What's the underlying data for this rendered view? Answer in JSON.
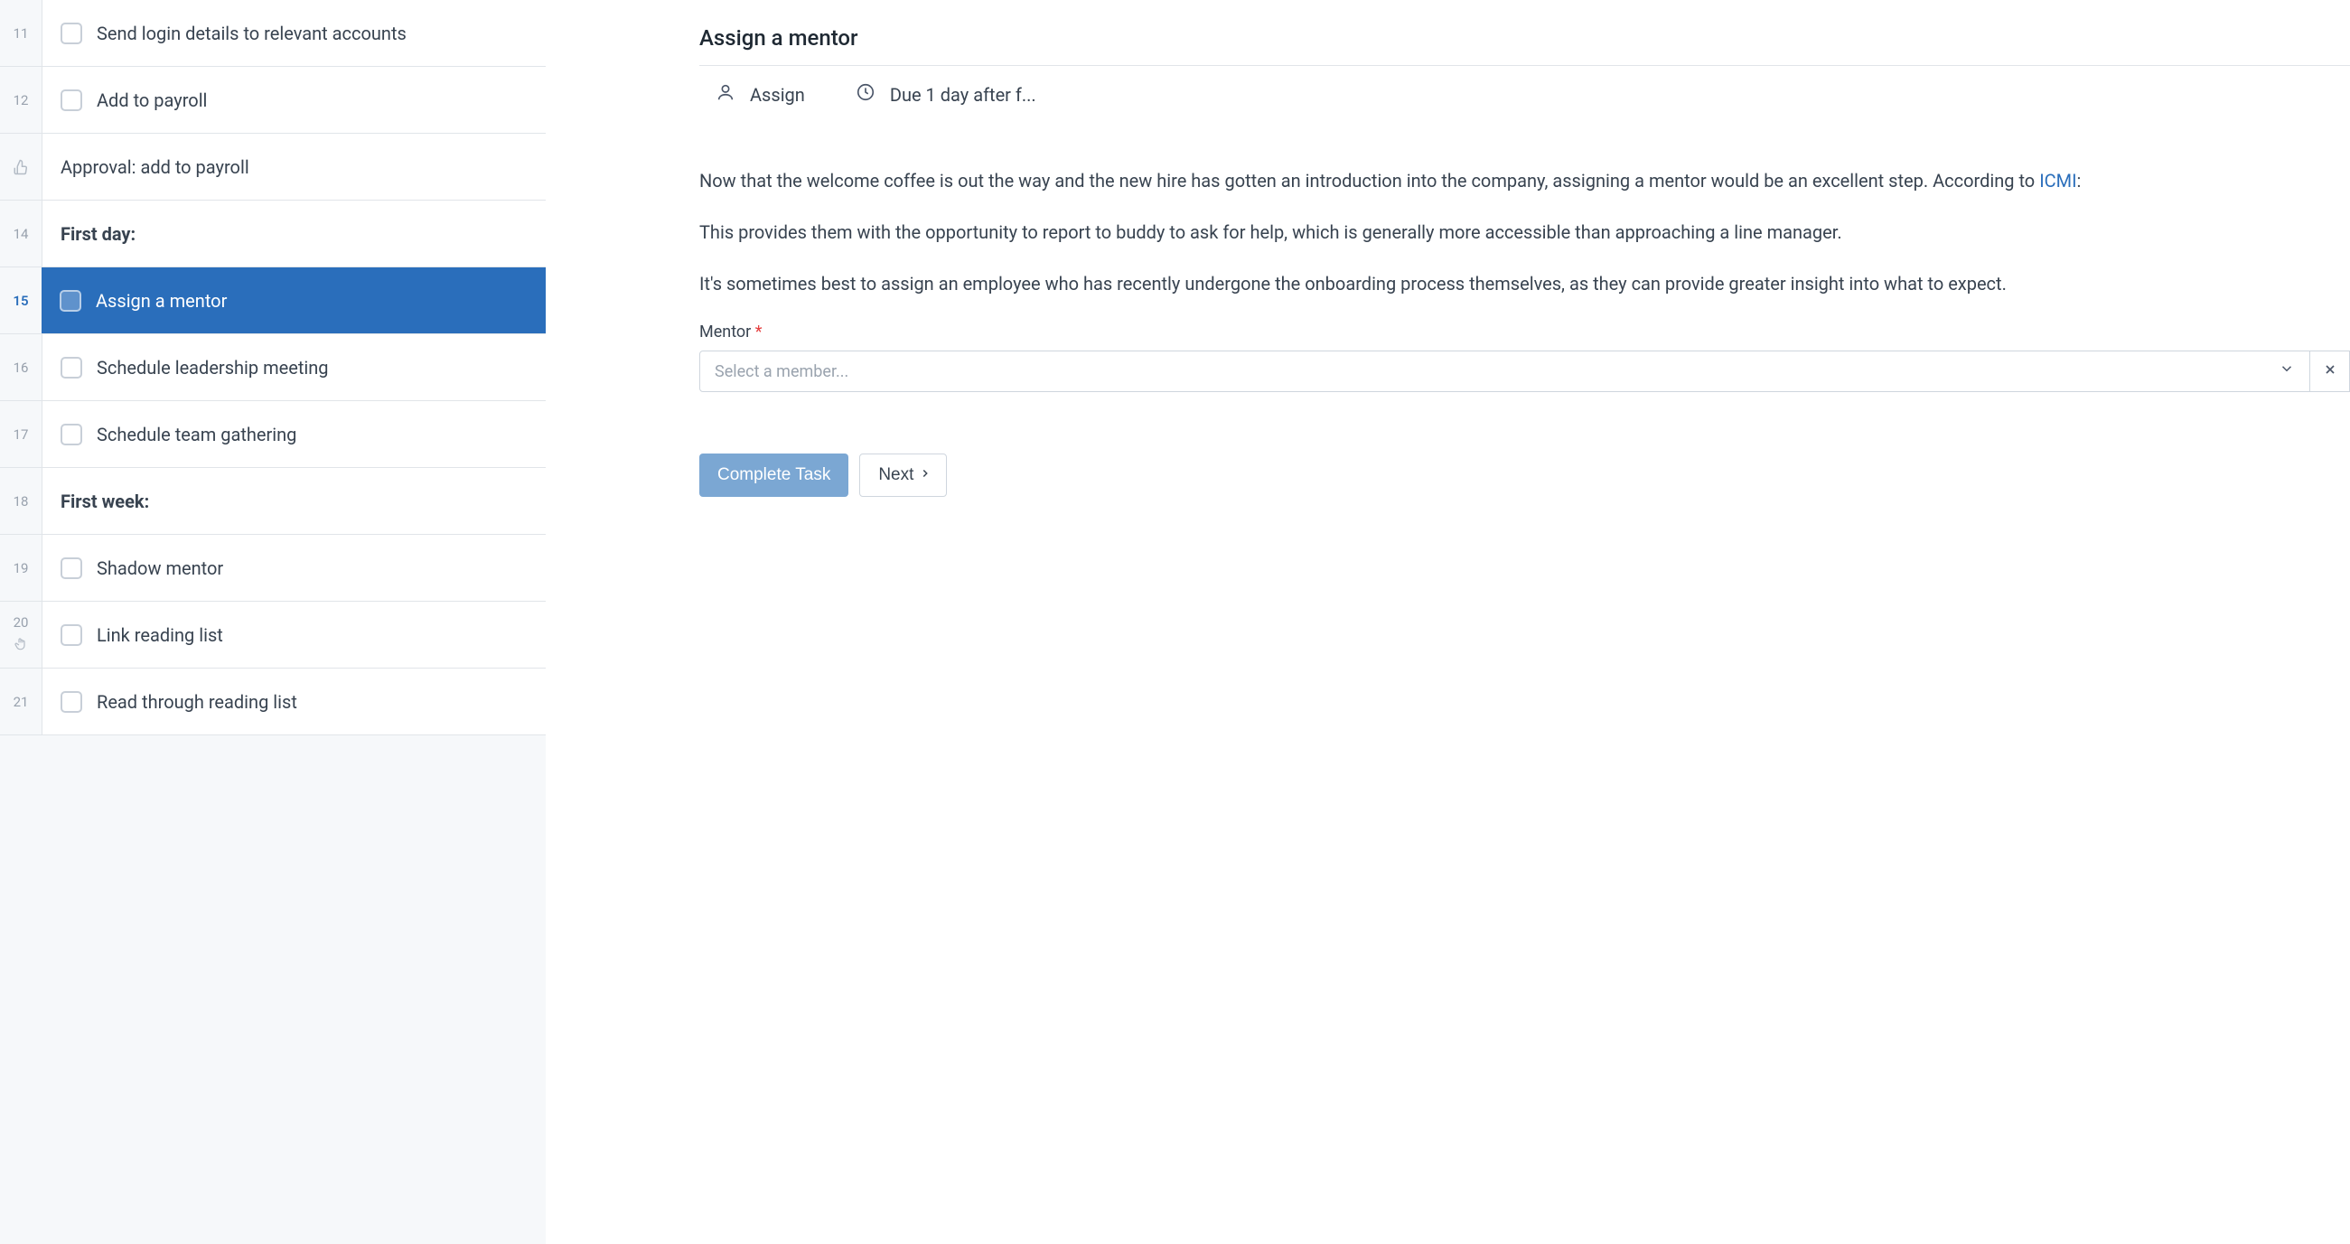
{
  "sidebar": {
    "rows": [
      {
        "num": "11",
        "type": "task",
        "label": "Send login details to relevant accounts"
      },
      {
        "num": "12",
        "type": "task",
        "label": "Add to payroll"
      },
      {
        "num": "",
        "type": "approval",
        "label": "Approval: add to payroll"
      },
      {
        "num": "14",
        "type": "heading",
        "label": "First day:"
      },
      {
        "num": "15",
        "type": "task",
        "label": "Assign a mentor",
        "active": true
      },
      {
        "num": "16",
        "type": "task",
        "label": "Schedule leadership meeting"
      },
      {
        "num": "17",
        "type": "task",
        "label": "Schedule team gathering"
      },
      {
        "num": "18",
        "type": "heading",
        "label": "First week:"
      },
      {
        "num": "19",
        "type": "task",
        "label": "Shadow mentor"
      },
      {
        "num": "20",
        "type": "task",
        "label": "Link reading list",
        "hasHand": true
      },
      {
        "num": "21",
        "type": "task",
        "label": "Read through reading list"
      }
    ]
  },
  "detail": {
    "title": "Assign a mentor",
    "meta_assign": "Assign",
    "meta_due": "Due 1 day after f...",
    "para1_prefix": "Now that the welcome coffee is out the way and the new hire has gotten an introduction into the company, assigning a mentor would be an excellent step. According to ",
    "para1_link": "ICMI",
    "para1_suffix": ":",
    "para2": "This provides them with the opportunity to report to buddy to ask for help, which is generally more accessible than approaching a line manager.",
    "para3": "It's sometimes best to assign an employee who has recently undergone the onboarding process themselves, as they can provide greater insight into what to expect.",
    "field_label": "Mentor ",
    "field_required": "*",
    "select_placeholder": "Select a member...",
    "btn_complete": "Complete Task",
    "btn_next": "Next"
  }
}
